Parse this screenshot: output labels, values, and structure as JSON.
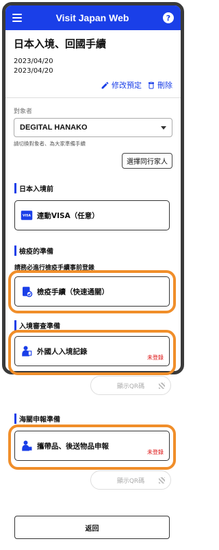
{
  "app": {
    "title": "Visit Japan Web"
  },
  "header": {
    "title": "日本入境、回國手續",
    "date_1": "2023/04/20",
    "date_2": "2023/04/20"
  },
  "actions": {
    "edit": "修改預定",
    "delete": "刪除"
  },
  "target": {
    "label": "對象者",
    "selected": "DEGITAL HANAKO",
    "hint": "請切換對象者、為大家準備手續",
    "companion_button": "選擇同行家人"
  },
  "sections": {
    "japan_entry": {
      "heading": "日本入境前",
      "card": "連動VISA（任意）"
    },
    "quarantine": {
      "heading": "檢疫的準備",
      "subheading": "請務必進行檢疫手續事前登錄",
      "card": "檢疫手續（快速通關）"
    },
    "immigration": {
      "heading": "入境審查準備",
      "card": "外國人入境記錄",
      "status": "未登錄",
      "qr": "顯示QR碼"
    },
    "customs": {
      "heading": "海關申報準備",
      "card": "攜帶品、後送物品申報",
      "status": "未登錄",
      "qr": "顯示QR碼"
    }
  },
  "footer": {
    "back": "返回"
  },
  "colors": {
    "brand": "#1a3fe8",
    "highlight": "#f08e2a",
    "status": "#dd1111"
  },
  "icons": [
    "menu-icon",
    "help-icon",
    "pencil-icon",
    "trash-icon",
    "visa-icon",
    "quarantine-icon",
    "passport-officer-icon",
    "customs-officer-icon",
    "qr-icon"
  ]
}
